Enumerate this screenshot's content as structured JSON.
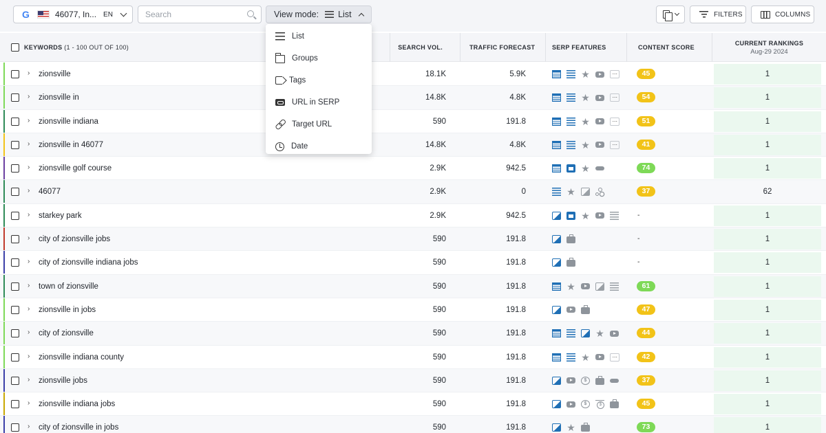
{
  "toolbar": {
    "location": {
      "engine": "G",
      "text": "46077, In...",
      "lang": "EN"
    },
    "search": {
      "placeholder": "Search"
    },
    "view_mode": {
      "label": "View mode:",
      "value": "List"
    },
    "filters_label": "FILTERS",
    "columns_label": "COLUMNS"
  },
  "dropdown": {
    "items": [
      {
        "label": "List",
        "icon": "list-icon"
      },
      {
        "label": "Groups",
        "icon": "folder-icon"
      },
      {
        "label": "Tags",
        "icon": "tag-icon"
      },
      {
        "label": "URL in SERP",
        "icon": "url-icon"
      },
      {
        "label": "Target URL",
        "icon": "link-icon"
      },
      {
        "label": "Date",
        "icon": "clock-icon"
      }
    ]
  },
  "table": {
    "headers": {
      "keywords": "KEYWORDS",
      "keywords_count": "(1 - 100 OUT OF 100)",
      "search_volume": "SEARCH VOL.",
      "traffic_forecast": "TRAFFIC FORECAST",
      "serp_features": "SERP FEATURES",
      "content_score": "CONTENT SCORE",
      "current_rankings": "CURRENT RANKINGS",
      "rankings_date": "Aug-29 2024"
    },
    "score_colors": {
      "yellow": "#f2c318",
      "green": "#7ed957"
    },
    "rows": [
      {
        "keyword": "zionsville",
        "search_volume": "18.1K",
        "traffic": "5.9K",
        "features": [
          "snippet",
          "list",
          "star",
          "video",
          "more"
        ],
        "score": "45",
        "score_color": "yellow",
        "ranking": "1",
        "bar": "#7ed957"
      },
      {
        "keyword": "zionsville in",
        "search_volume": "14.8K",
        "traffic": "4.8K",
        "features": [
          "snippet",
          "list",
          "star",
          "video",
          "more"
        ],
        "score": "54",
        "score_color": "yellow",
        "ranking": "1",
        "bar": "#7ed957"
      },
      {
        "keyword": "zionsville indiana",
        "search_volume": "590",
        "traffic": "191.8",
        "features": [
          "snippet",
          "list",
          "star",
          "video",
          "more"
        ],
        "score": "51",
        "score_color": "yellow",
        "ranking": "1",
        "bar": "#2e8b57"
      },
      {
        "keyword": "zionsville in 46077",
        "search_volume": "14.8K",
        "traffic": "4.8K",
        "features": [
          "snippet",
          "list",
          "star",
          "video",
          "more"
        ],
        "score": "41",
        "score_color": "yellow",
        "ranking": "1",
        "bar": "#f2c318"
      },
      {
        "keyword": "zionsville golf course",
        "search_volume": "2.9K",
        "traffic": "942.5",
        "features": [
          "snippet",
          "calendar",
          "star",
          "link"
        ],
        "score": "74",
        "score_color": "green",
        "ranking": "1",
        "bar": "#6a3fa0"
      },
      {
        "keyword": "46077",
        "search_volume": "2.9K",
        "traffic": "0",
        "features": [
          "list",
          "star",
          "image-gray",
          "tree"
        ],
        "score": "37",
        "score_color": "yellow",
        "ranking": "62",
        "bar": "#2e8b57"
      },
      {
        "keyword": "starkey park",
        "search_volume": "2.9K",
        "traffic": "942.5",
        "features": [
          "image",
          "calendar",
          "star",
          "video",
          "list-gray"
        ],
        "score": "-",
        "score_color": "none",
        "ranking": "1",
        "bar": "#2e8b57"
      },
      {
        "keyword": "city of zionsville jobs",
        "search_volume": "590",
        "traffic": "191.8",
        "features": [
          "image",
          "bag"
        ],
        "score": "-",
        "score_color": "none",
        "ranking": "1",
        "bar": "#c0392b"
      },
      {
        "keyword": "city of zionsville indiana jobs",
        "search_volume": "590",
        "traffic": "191.8",
        "features": [
          "image",
          "bag"
        ],
        "score": "-",
        "score_color": "none",
        "ranking": "1",
        "bar": "#3b3fa8"
      },
      {
        "keyword": "town of zionsville",
        "search_volume": "590",
        "traffic": "191.8",
        "features": [
          "snippet",
          "star",
          "video",
          "image-gray",
          "list-gray"
        ],
        "score": "61",
        "score_color": "green",
        "ranking": "1",
        "bar": "#2e8b57"
      },
      {
        "keyword": "zionsville in jobs",
        "search_volume": "590",
        "traffic": "191.8",
        "features": [
          "image",
          "video",
          "bag"
        ],
        "score": "47",
        "score_color": "yellow",
        "ranking": "1",
        "bar": "#7ed957"
      },
      {
        "keyword": "city of zionsville",
        "search_volume": "590",
        "traffic": "191.8",
        "features": [
          "snippet",
          "list",
          "image",
          "star",
          "video"
        ],
        "score": "44",
        "score_color": "yellow",
        "ranking": "1",
        "bar": "#7ed957"
      },
      {
        "keyword": "zionsville indiana county",
        "search_volume": "590",
        "traffic": "191.8",
        "features": [
          "snippet",
          "list",
          "star",
          "video",
          "more"
        ],
        "score": "42",
        "score_color": "yellow",
        "ranking": "1",
        "bar": "#7ed957"
      },
      {
        "keyword": "zionsville jobs",
        "search_volume": "590",
        "traffic": "191.8",
        "features": [
          "image",
          "video",
          "coin",
          "bag",
          "link"
        ],
        "score": "37",
        "score_color": "yellow",
        "ranking": "1",
        "bar": "#3b3fa8"
      },
      {
        "keyword": "zionsville indiana jobs",
        "search_volume": "590",
        "traffic": "191.8",
        "features": [
          "image",
          "video",
          "coin",
          "hotel",
          "bag"
        ],
        "score": "45",
        "score_color": "yellow",
        "ranking": "1",
        "bar": "#c9a800"
      },
      {
        "keyword": "city of zionsville in jobs",
        "search_volume": "590",
        "traffic": "191.8",
        "features": [
          "image",
          "star",
          "bag"
        ],
        "score": "73",
        "score_color": "green",
        "ranking": "1",
        "bar": "#3b3fa8"
      }
    ]
  }
}
